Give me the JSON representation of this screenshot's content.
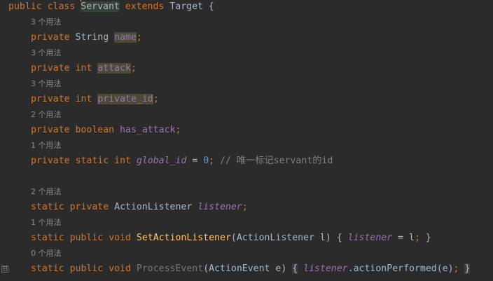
{
  "class_decl": {
    "kw_public": "public",
    "kw_class": "class",
    "class_name": "Servant",
    "kw_extends": "extends",
    "parent": "Target",
    "open_brace": "{"
  },
  "fields": [
    {
      "usage": "3 个用法",
      "modifiers": "private",
      "type": "String",
      "name": "name"
    },
    {
      "usage": "3 个用法",
      "modifiers": "private",
      "type": "int",
      "name": "attack"
    },
    {
      "usage": "3 个用法",
      "modifiers": "private",
      "type": "int",
      "name": "private_id"
    },
    {
      "usage": "2 个用法",
      "modifiers": "private",
      "type": "boolean",
      "name": "has_attack"
    }
  ],
  "global_field": {
    "usage": "1 个用法",
    "kw_private": "private",
    "kw_static": "static",
    "type": "int",
    "name": "global_id",
    "value": "0",
    "comment": "// 唯一标记servant的id"
  },
  "listener_field": {
    "usage": "2 个用法",
    "kw_static": "static",
    "kw_private": "private",
    "type": "ActionListener",
    "name": "listener"
  },
  "set_method": {
    "usage": "1 个用法",
    "kw_static": "static",
    "kw_public": "public",
    "kw_void": "void",
    "name": "SetActionListener",
    "params": "(ActionListener l)",
    "body_open": "{",
    "field": "listener",
    "body_rest": " = l",
    "close": "}"
  },
  "process_method": {
    "usage": "0 个用法",
    "kw_static": "static",
    "kw_public": "public",
    "kw_void": "void",
    "name": "ProcessEvent",
    "params": "(ActionEvent e)",
    "body_open": "{",
    "field": "listener",
    "call": ".actionPerformed(e)",
    "close": "}"
  },
  "fold_icon": "⊟",
  "colors": {
    "background": "#2b2b2b",
    "keyword": "#cc7832",
    "field": "#9876aa",
    "method": "#ffc66d",
    "number": "#6897bb",
    "comment": "#808080",
    "text": "#a9b7c6",
    "hint": "#8c8c8c"
  }
}
